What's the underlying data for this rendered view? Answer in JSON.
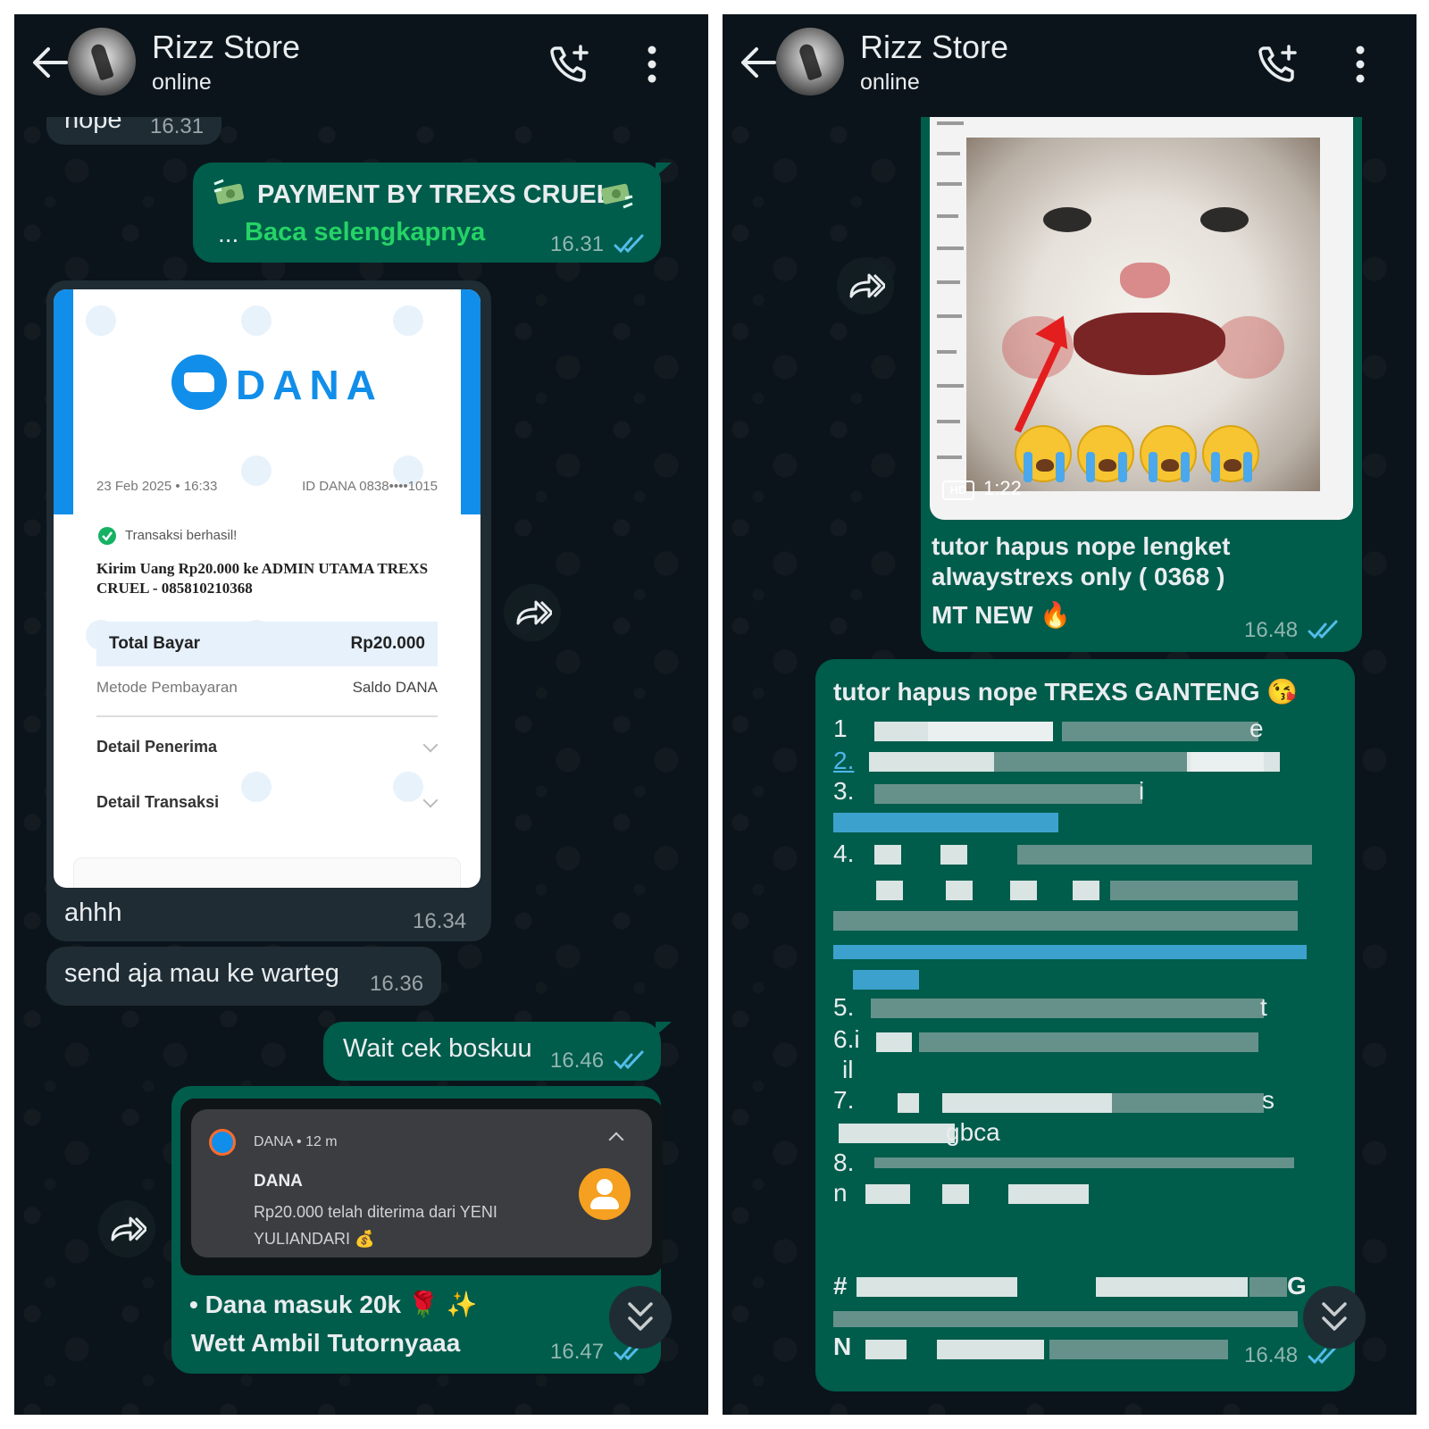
{
  "colors": {
    "background": "#0b141a",
    "incoming_bubble": "#1f2c34",
    "outgoing_bubble": "#005c4b",
    "read_ticks": "#53bdeb",
    "link_green": "#25d366",
    "dana_blue": "#118ee9"
  },
  "left": {
    "header": {
      "contact_name": "Rizz Store",
      "status": "online",
      "icons": [
        "back-arrow-icon",
        "add-call-icon",
        "more-vertical-icon"
      ]
    },
    "messages": {
      "cut_top": {
        "text": "nope",
        "time": "16.31"
      },
      "payment": {
        "title": "PAYMENT BY TREXS CRUEL",
        "read_more_prefix": "...",
        "read_more": "Baca selengkapnya",
        "time": "16.31"
      },
      "receipt": {
        "brand": "DANA",
        "date": "23 Feb 2025 • 16:33",
        "id": "ID DANA 0838••••1015",
        "status": "Transaksi berhasil!",
        "description": "Kirim Uang Rp20.000 ke ADMIN UTAMA TREXS CRUEL - 085810210368",
        "total_label": "Total Bayar",
        "total_value": "Rp20.000",
        "method_label": "Metode Pembayaran",
        "method_value": "Saldo DANA",
        "detail_recipient": "Detail Penerima",
        "detail_transaction": "Detail Transaksi"
      },
      "ahhh": {
        "text": "ahhh",
        "time": "16.34"
      },
      "send": {
        "text": "send aja mau ke warteg",
        "time": "16.36"
      },
      "wait": {
        "text": "Wait cek boskuu",
        "time": "16.46"
      },
      "notification": {
        "app_line": "DANA • 12 m",
        "title": "DANA",
        "body": "Rp20.000 telah diterima dari YENI YULIANDARI 💰"
      },
      "dana_masuk": {
        "line1": "• Dana masuk 20k 🌹 ✨",
        "line2": "Wett Ambil Tutornyaaa",
        "time": "16.47"
      }
    }
  },
  "right": {
    "header": {
      "contact_name": "Rizz Store",
      "status": "online",
      "icons": [
        "back-arrow-icon",
        "add-call-icon",
        "more-vertical-icon"
      ]
    },
    "media_message": {
      "duration": "1:22",
      "hd_badge": "HD",
      "caption_line1": "tutor hapus nope lengket",
      "caption_line2": "alwaystrexs only ( 0368 )",
      "caption_line3": "MT NEW 🔥",
      "time": "16.48"
    },
    "tutor_message": {
      "title": "tutor hapus nope TREXS GANTENG 😘",
      "line_1": "1",
      "line_1_end": "e",
      "line_2": "2.",
      "line_3": "3.",
      "line_3_end": "i",
      "line_4": "4.",
      "line_5": "5.",
      "line_5_end": "t",
      "line_6": "6.i",
      "line_6b": "il",
      "line_7": "7.",
      "line_7_end": "s",
      "line_7b": "gbca",
      "line_8": "8.",
      "line_8b": "n",
      "hashtag_prefix": "#",
      "hashtag_end": "G",
      "last_prefix": "N",
      "time": "16.48"
    }
  }
}
